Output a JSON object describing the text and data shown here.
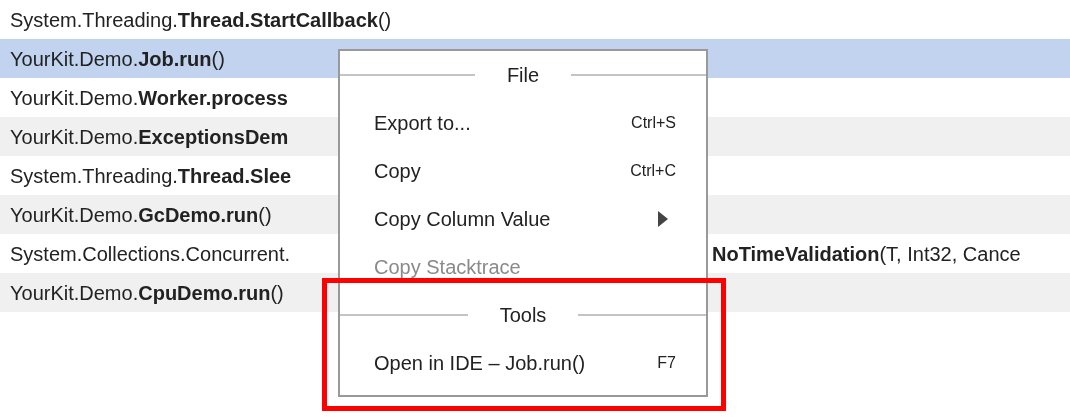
{
  "rows": [
    {
      "text": "System.Threading.**Thread.StartCallback**()",
      "selected": false
    },
    {
      "text": "YourKit.Demo.**Job.run**()",
      "selected": true
    },
    {
      "text": "YourKit.Demo.**Worker.process**",
      "selected": false
    },
    {
      "text": "YourKit.Demo.**ExceptionsDem**",
      "selected": false
    },
    {
      "text": "System.Threading.**Thread.Slee**",
      "selected": false
    },
    {
      "text": "YourKit.Demo.**GcDemo.run**()",
      "selected": false
    },
    {
      "text": "System.Collections.Concurrent.",
      "text_right": "**NoTimeValidation**(T, Int32, Cance",
      "selected": false
    },
    {
      "text": "YourKit.Demo.**CpuDemo.run**()",
      "selected": false
    }
  ],
  "context_menu": {
    "sections": [
      {
        "title": "File",
        "highlighted": false,
        "items": [
          {
            "label": "Export to...",
            "shortcut": "Ctrl+S",
            "disabled": false,
            "submenu": false
          },
          {
            "label": "Copy",
            "shortcut": "Ctrl+C",
            "disabled": false,
            "submenu": false
          },
          {
            "label": "Copy Column Value",
            "disabled": false,
            "submenu": true
          },
          {
            "label": "Copy Stacktrace",
            "disabled": true,
            "submenu": false
          }
        ]
      },
      {
        "title": "Tools",
        "highlighted": true,
        "items": [
          {
            "label": "Open in IDE – Job.run()",
            "shortcut": "F7",
            "disabled": false,
            "submenu": false
          }
        ]
      }
    ]
  }
}
